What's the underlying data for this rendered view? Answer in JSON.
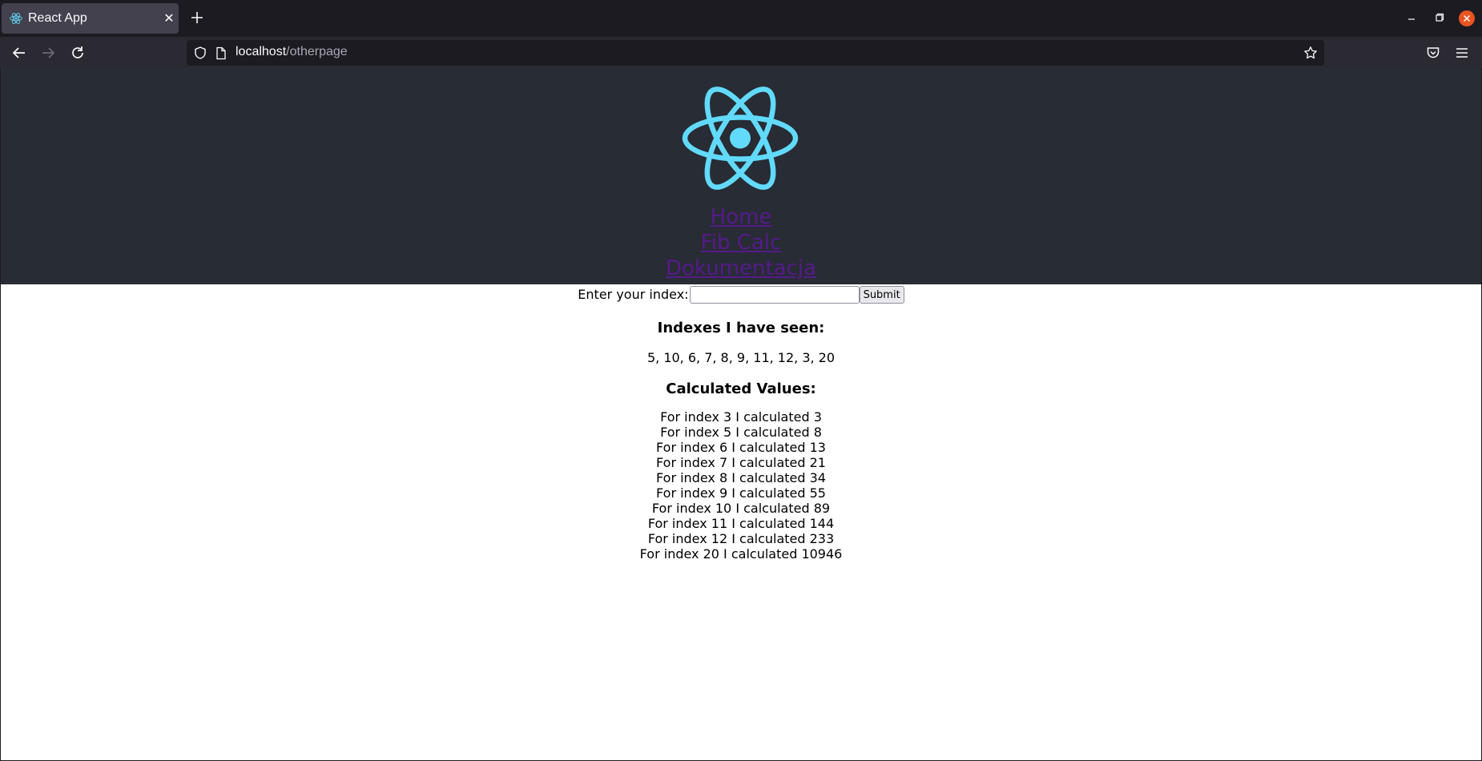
{
  "browser": {
    "tab_title": "React App",
    "url_host": "localhost",
    "url_path": "/otherpage"
  },
  "nav": {
    "links": [
      "Home",
      "Fib Calc",
      "Dokumentacja"
    ]
  },
  "form": {
    "label": "Enter your index:",
    "input_value": "",
    "submit_label": "Submit"
  },
  "seen": {
    "heading": "Indexes I have seen:",
    "list": "5, 10, 6, 7, 8, 9, 11, 12, 3, 20"
  },
  "calculated": {
    "heading": "Calculated Values:",
    "rows": [
      "For index 3 I calculated 3",
      "For index 5 I calculated 8",
      "For index 6 I calculated 13",
      "For index 7 I calculated 21",
      "For index 8 I calculated 34",
      "For index 9 I calculated 55",
      "For index 10 I calculated 89",
      "For index 11 I calculated 144",
      "For index 12 I calculated 233",
      "For index 20 I calculated 10946"
    ]
  },
  "colors": {
    "header_bg": "#282c34",
    "react_logo": "#61dafb",
    "visited_link": "#551a8b",
    "close_button": "#e95420"
  },
  "icons": [
    "react-favicon-icon",
    "close-icon",
    "plus-icon",
    "minimize-icon",
    "restore-icon",
    "window-close-icon",
    "back-arrow-icon",
    "forward-arrow-icon",
    "reload-icon",
    "shield-icon",
    "page-icon",
    "star-icon",
    "pocket-icon",
    "hamburger-menu-icon",
    "react-logo-icon"
  ]
}
